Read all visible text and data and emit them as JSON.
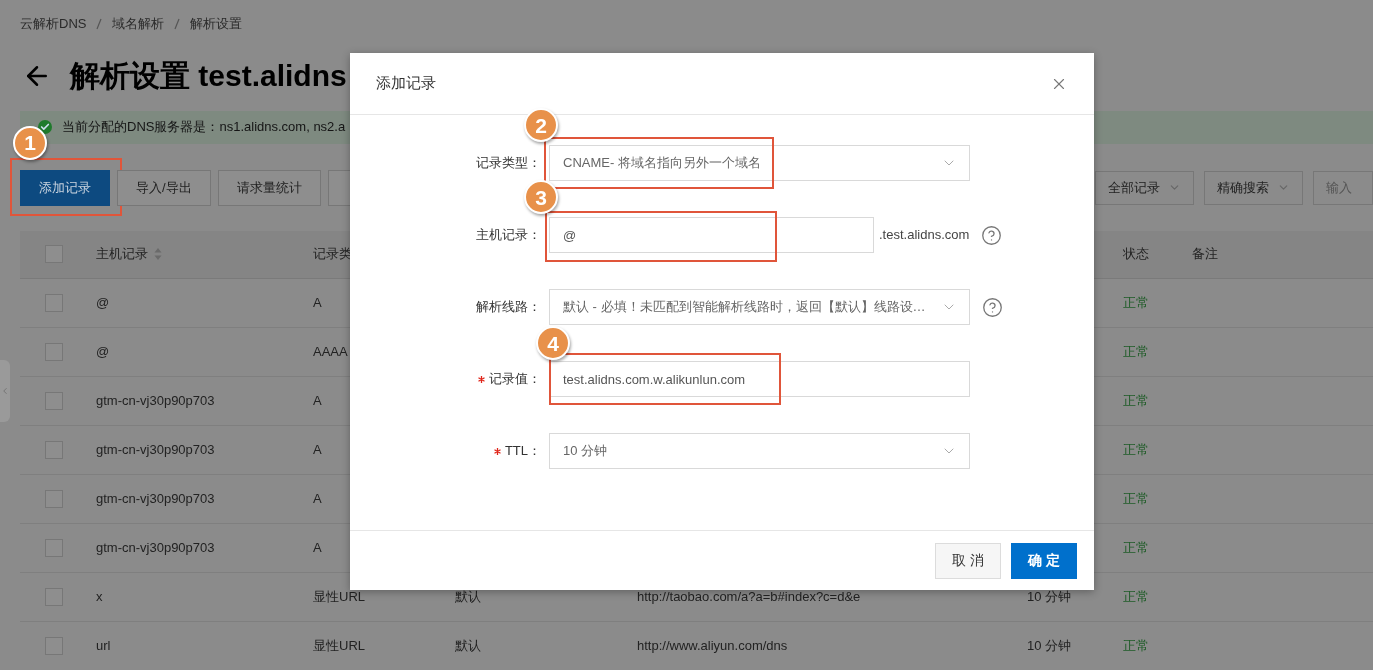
{
  "breadcrumb": [
    "云解析DNS",
    "域名解析",
    "解析设置"
  ],
  "page_title": "解析设置 test.alidns",
  "notice": {
    "text": "当前分配的DNS服务器是：ns1.alidns.com, ns2.a"
  },
  "toolbar": {
    "buttons": [
      {
        "label": "添加记录",
        "primary": true,
        "callout": "1"
      },
      {
        "label": "导入/导出",
        "primary": false
      },
      {
        "label": "请求量统计",
        "primary": false
      }
    ],
    "filters": [
      {
        "label": "全部记录"
      },
      {
        "label": "精确搜索"
      }
    ],
    "search": {
      "placeholder": "输入"
    }
  },
  "table": {
    "select_all": {
      "checked": false
    },
    "columns": [
      {
        "label": "主机记录",
        "sortable": true
      },
      {
        "label": "记录类"
      },
      {
        "label": "状态",
        "sortable": false
      },
      {
        "label": "备注",
        "sortable": false
      }
    ],
    "rows": [
      {
        "checked": false,
        "host": "@",
        "type": "A",
        "status": "正常"
      },
      {
        "checked": false,
        "host": "@",
        "type": "AAAA",
        "status": "正常"
      },
      {
        "checked": false,
        "host": "gtm-cn-vj30p90p703",
        "type": "A",
        "status": "正常"
      },
      {
        "checked": false,
        "host": "gtm-cn-vj30p90p703",
        "type": "A",
        "status": "正常"
      },
      {
        "checked": false,
        "host": "gtm-cn-vj30p90p703",
        "type": "A",
        "status": "正常"
      },
      {
        "checked": false,
        "host": "gtm-cn-vj30p90p703",
        "type": "A",
        "status": "正常"
      },
      {
        "checked": false,
        "host": "x",
        "type": "显性URL",
        "line": "默认",
        "value": "http://taobao.com/a?a=b#index?c=d&e",
        "ttl": "10 分钟",
        "status": "正常"
      },
      {
        "checked": false,
        "host": "url",
        "type": "显性URL",
        "line": "默认",
        "value": "http://www.aliyun.com/dns",
        "ttl": "10 分钟",
        "status": "正常"
      }
    ]
  },
  "dialog": {
    "title": "添加记录",
    "fields": [
      {
        "label": "记录类型：",
        "kind": "select",
        "value": "CNAME- 将域名指向另外一个域名",
        "required": false,
        "help": false,
        "callout": "2"
      },
      {
        "label": "主机记录：",
        "kind": "input",
        "value": "@",
        "suffix": ".test.alidns.com",
        "required": false,
        "help": true,
        "callout": "3"
      },
      {
        "label": "解析线路：",
        "kind": "select",
        "value": "默认 - 必填！未匹配到智能解析线路时，返回【默认】线路设…",
        "required": false,
        "help": true
      },
      {
        "label": "记录值：",
        "kind": "input",
        "value": "test.alidns.com.w.alikunlun.com",
        "required": true,
        "help": false,
        "callout": "4"
      },
      {
        "label": "TTL：",
        "kind": "select",
        "value": "10 分钟",
        "required": true,
        "help": false
      }
    ],
    "buttons": [
      {
        "label": "取 消",
        "primary": false
      },
      {
        "label": "确 定",
        "primary": true
      }
    ]
  }
}
